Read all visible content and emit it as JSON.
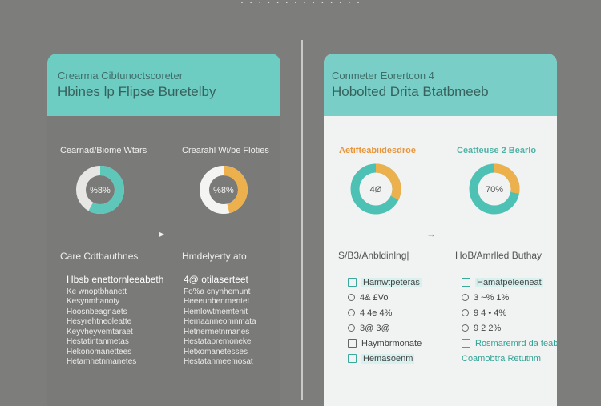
{
  "top_caption": "· · · · · · · · · · · · · ·",
  "left_card": {
    "kicker": "Crearma Cibtunoctscoreter",
    "title": "Hbines lp Flipse Buretelby",
    "chart1": {
      "label": "Cearnad/Biome Wtars",
      "value": "%8%",
      "fraction": 0.58,
      "color": "#5fc6ba"
    },
    "chart2": {
      "label": "Crearahl Wi/be Floties",
      "value": "%8%",
      "fraction": 0.46,
      "color": "#ecb04d"
    },
    "arrow1": "▸",
    "section1": "Care Cdtbauthnes",
    "section2": "Hmdelyerty ato",
    "list1_lead": "Hbsb enettornleeabeth",
    "list1": [
      "Ke wnoptbhanett",
      "Kesynmhanoty",
      "Hoosnbeagnaets",
      "Hesyrehtneoleatte",
      "Keyvheyvemtaraet",
      "Hestatintanmetas",
      "Hekonomanettees",
      "Hetamhetnmanetes"
    ],
    "list2_lead": "4@ otilaserteet",
    "list2": [
      "Fo%a cnynhemunt",
      "Heeeunbenmentet",
      "Hemlowtmemtenit",
      "Hemaanneomnmata",
      "Hetnermetnmanes",
      "Hestatapremoneke",
      "Hetxomanetesses",
      "Hestatanmeemosat"
    ]
  },
  "right_card": {
    "kicker": "Conmeter Eorertcon 4",
    "title": "Hobolted Drita Btatbmeeb",
    "chart1": {
      "label": "Aetifteabiidesdroe",
      "value": "4Ø",
      "fraction": 0.32,
      "color": "#ecb04d",
      "base": "#4dc1b4"
    },
    "chart2": {
      "label": "Ceatteuse 2 Bearlo",
      "value": "70%",
      "fraction": 0.28,
      "color": "#ecb04d",
      "base": "#4dc1b4"
    },
    "arrow1": "→",
    "section1": "S/B3/Anbldinlng|",
    "section2": "HoB/Amrlled Buthay",
    "list1": [
      {
        "kind": "check",
        "text": "Hamwtpeteras",
        "highlight": true
      },
      {
        "kind": "dot",
        "text": "4& £Vo"
      },
      {
        "kind": "dot",
        "text": "4 4e 4%"
      },
      {
        "kind": "dot",
        "text": "3@ 3@"
      },
      {
        "kind": "check",
        "text": "Haymbrmonate",
        "highlight": false
      },
      {
        "kind": "check",
        "text": "Hemasoenm",
        "highlight": true
      }
    ],
    "list2": [
      {
        "kind": "check",
        "text": "Hamatpeleeneat",
        "highlight": true
      },
      {
        "kind": "dot",
        "text": "3 ~% 1%"
      },
      {
        "kind": "dot",
        "text": "9 4 • 4%"
      },
      {
        "kind": "dot",
        "text": "9 2 2%"
      },
      {
        "kind": "check",
        "text": "Rosmaremrd da teaboe",
        "teal": true
      },
      {
        "kind": "text",
        "text": "Coamobtra Retutnm",
        "teal": true
      }
    ]
  }
}
